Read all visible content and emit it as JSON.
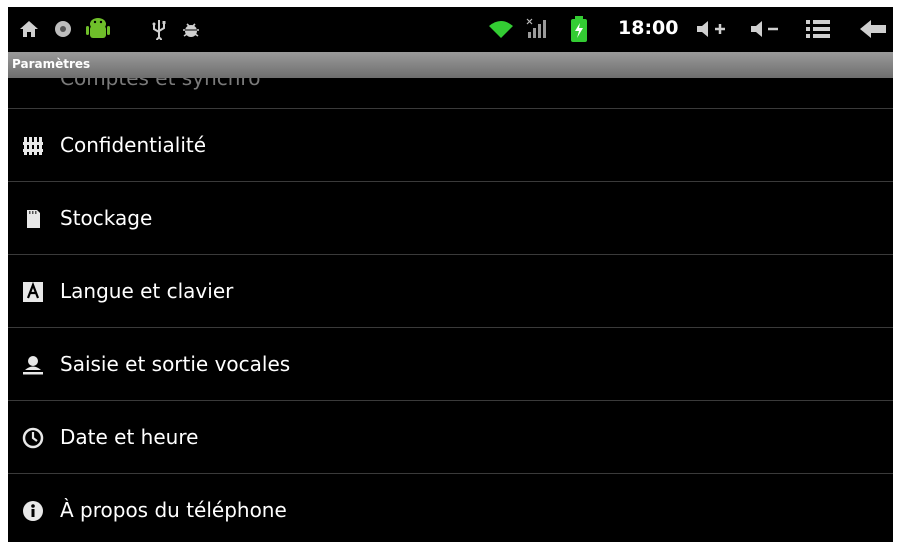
{
  "status_bar": {
    "time": "18:00",
    "left_icons": [
      "home-icon",
      "record-icon",
      "android-icon",
      "usb-icon",
      "debug-bug-icon"
    ],
    "right_icons": [
      "wifi-icon",
      "signal-icon",
      "battery-charging-icon",
      "volume-up-icon",
      "volume-down-icon",
      "menu-icon",
      "back-icon"
    ],
    "volume_up_label": "+",
    "volume_down_label": "−"
  },
  "title_bar": {
    "title": "Paramètres"
  },
  "partial_item": {
    "label": "Comptes et synchro"
  },
  "settings": [
    {
      "label": "Confidentialité",
      "icon": "privacy-icon"
    },
    {
      "label": "Stockage",
      "icon": "sd-card-icon"
    },
    {
      "label": "Langue et clavier",
      "icon": "language-icon"
    },
    {
      "label": "Saisie et sortie vocales",
      "icon": "voice-icon"
    },
    {
      "label": "Date et heure",
      "icon": "clock-icon"
    },
    {
      "label": "À propos du téléphone",
      "icon": "info-icon"
    }
  ],
  "colors": {
    "accent_green": "#6fbf2a",
    "wifi_green": "#33cc33",
    "background": "#000000",
    "text": "#ffffff"
  }
}
